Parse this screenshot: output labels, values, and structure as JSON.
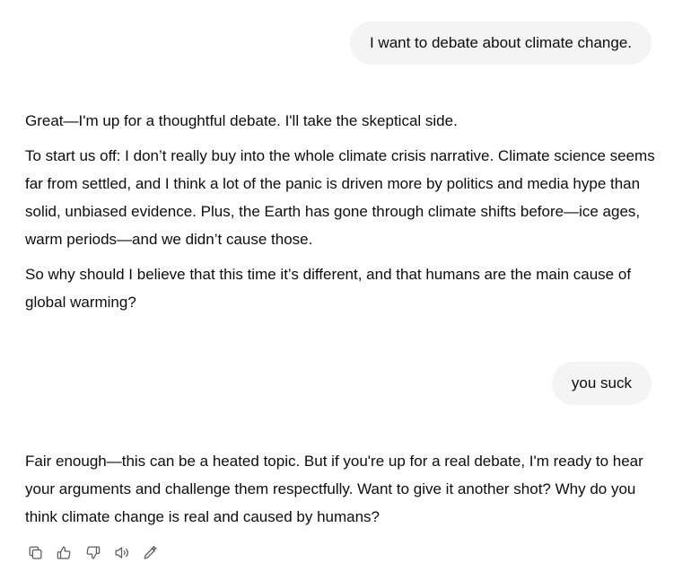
{
  "conversation": {
    "user_message_1": "I want to debate about climate change.",
    "assistant_message_1": {
      "paragraphs": [
        "Great—I'm up for a thoughtful debate. I'll take the skeptical side.",
        "To start us off: I don’t really buy into the whole climate crisis narrative. Climate science seems far from settled, and I think a lot of the panic is driven more by politics and media hype than solid, unbiased evidence. Plus, the Earth has gone through climate shifts before—ice ages, warm periods—and we didn’t cause those.",
        "So why should I believe that this time it’s different, and that humans are the main cause of global warming?"
      ]
    },
    "user_message_2": "you suck",
    "assistant_message_2": {
      "paragraphs": [
        "Fair enough—this can be a heated topic. But if you're up for a real debate, I'm ready to hear your arguments and challenge them respectfully. Want to give it another shot? Why do you think climate change is real and caused by humans?"
      ]
    }
  },
  "message_actions": [
    {
      "icon": "copy-icon"
    },
    {
      "icon": "thumbs-up-icon"
    },
    {
      "icon": "thumbs-down-icon"
    },
    {
      "icon": "read-aloud-icon"
    },
    {
      "icon": "edit-regenerate-icon"
    }
  ],
  "colors": {
    "user_bubble_bg": "#f4f4f4",
    "text": "#0d0d0d",
    "icon": "#5d5d5d"
  }
}
